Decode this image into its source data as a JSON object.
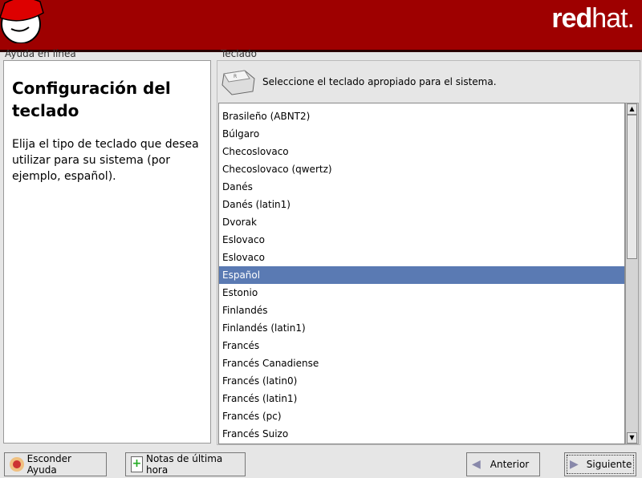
{
  "banner": {
    "brand_bold": "red",
    "brand_light": "hat."
  },
  "help": {
    "label": "Ayuda en línea",
    "title": "Configuración del teclado",
    "body": "Elija el tipo de teclado que desea utilizar para su sistema (por ejemplo, español)."
  },
  "keyboard": {
    "label": "Teclado",
    "prompt": "Seleccione el teclado apropiado para el sistema.",
    "items": [
      "Brasileño (ABNT2)",
      "Búlgaro",
      "Checoslovaco",
      "Checoslovaco (qwertz)",
      "Danés",
      "Danés (latin1)",
      "Dvorak",
      "Eslovaco",
      "Eslovaco",
      "Español",
      "Estonio",
      "Finlandés",
      "Finlandés (latin1)",
      "Francés",
      "Francés Canadiense",
      "Francés (latin0)",
      "Francés (latin1)",
      "Francés (pc)",
      "Francés Suizo"
    ],
    "selected": "Español"
  },
  "buttons": {
    "hide_help": "Esconder Ayuda",
    "release_notes": "Notas de última hora",
    "back": "Anterior",
    "next": "Siguiente"
  }
}
